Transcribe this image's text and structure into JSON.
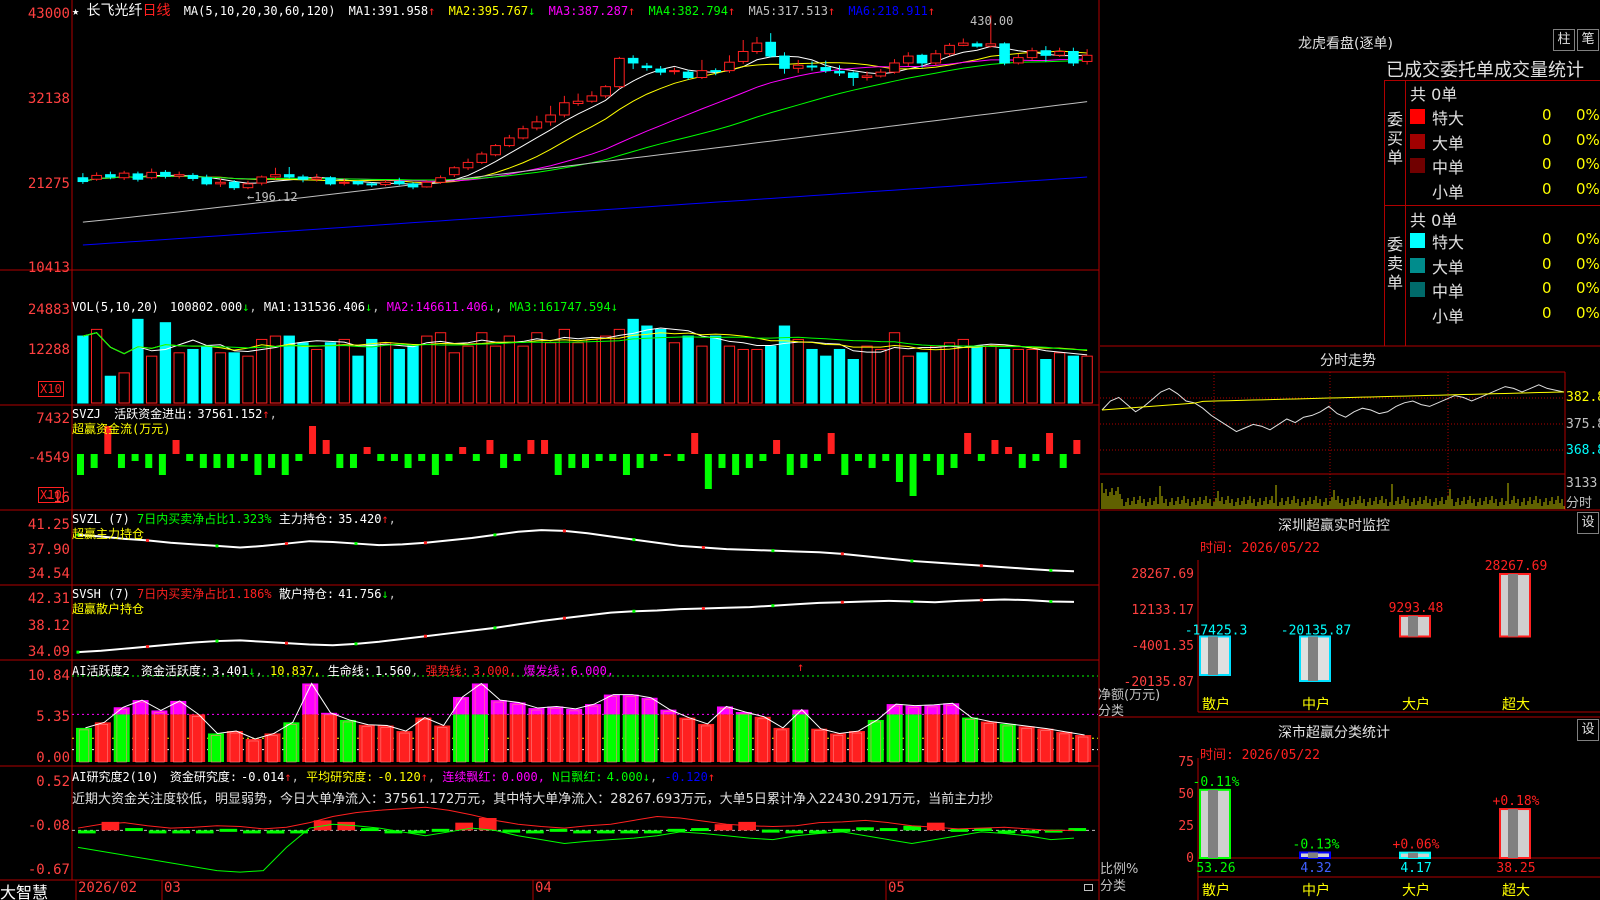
{
  "colors": {
    "up": "#ff2020",
    "down": "#00ffff",
    "grid": "#b00000",
    "ma1": "#ffffff",
    "ma2": "#ffff00",
    "ma3": "#ff00ff",
    "ma4": "#00ff00",
    "ma5": "#c0c0c0",
    "ma6": "#0000ff",
    "green": "#00ff00",
    "magenta": "#ff00ff"
  },
  "stock": {
    "name": "长飞光纤",
    "period": "日线"
  },
  "main": {
    "ma_label": "MA(5,10,20,30,60,120)",
    "ma": [
      {
        "k": "MA1:",
        "v": "391.958"
      },
      {
        "k": "MA2:",
        "v": "395.767"
      },
      {
        "k": "MA3:",
        "v": "387.287"
      },
      {
        "k": "MA4:",
        "v": "382.794"
      },
      {
        "k": "MA5:",
        "v": "317.513"
      },
      {
        "k": "MA6:",
        "v": "218.911"
      }
    ],
    "y_ticks": [
      "43000",
      "32138",
      "21275",
      "10413"
    ],
    "high_label": "430.00",
    "low_label": "196.12",
    "star": "★"
  },
  "vol": {
    "label": "VOL(5,10,20)",
    "value": "100802.000",
    "ma": [
      {
        "k": "MA1:",
        "v": "131536.406"
      },
      {
        "k": "MA2:",
        "v": "146611.406"
      },
      {
        "k": "MA3:",
        "v": "161747.594"
      }
    ],
    "y_ticks": [
      "24883",
      "12288"
    ],
    "unit": "X10"
  },
  "svzj": {
    "label": "SVZJ",
    "title": "活跃资金进出:",
    "value": "37561.152",
    "sub": "超赢资金流(万元)",
    "y_ticks": [
      "7432",
      "-4549",
      "-16"
    ],
    "unit": "X10"
  },
  "svzl": {
    "label": "SVZL (7)",
    "pct": "7日内买卖净占比1.323%",
    "k": "主力持仓:",
    "v": "35.420",
    "sub": "超赢主力持仓",
    "y_ticks": [
      "41.25",
      "37.90",
      "34.54"
    ]
  },
  "svsh": {
    "label": "SVSH (7)",
    "pct": "7日内买卖净占比1.186%",
    "k": "散户持仓:",
    "v": "41.756",
    "sub": "超赢散户持仓",
    "y_ticks": [
      "42.31",
      "38.12",
      "34.09"
    ]
  },
  "ai1": {
    "label": "AI活跃度2",
    "k1": "资金活跃度:",
    "v1": "3.401",
    "v2": "10.837",
    "k3": "生命线:",
    "v3": "1.560",
    "k4": "强势线:",
    "v4": "3.000",
    "k5": "爆发线:",
    "v5": "6.000",
    "y_ticks": [
      "10.84",
      "5.35",
      "0.00"
    ]
  },
  "ai2": {
    "label": "AI研究度2(10)",
    "k1": "资金研究度:",
    "v1": "-0.014",
    "k2": "平均研究度:",
    "v2": "-0.120",
    "k3": "连续飘红:",
    "v3": "0.000",
    "k4": "N日飘红:",
    "v4": "4.000",
    "v5": "-0.120",
    "note": "近期大资金关注度较低，明显弱势，今日大单净流入：37561.172万元，其中特大单净流入：28267.693万元，大单5日累计净入22430.291万元，当前主力抄",
    "y_ticks": [
      "0.52",
      "-0.08",
      "-0.67"
    ]
  },
  "xaxis": {
    "brand": "大智慧",
    "labels": [
      "2026/02",
      "03",
      "04",
      "05"
    ]
  },
  "right": {
    "lhb_title": "龙虎看盘(逐单)",
    "btn1": "柱",
    "btn2": "笔",
    "tabs": "已成交委托单成交量统计",
    "buy": {
      "side": "委买单",
      "total": "共 0单",
      "rows": [
        {
          "n": "特大",
          "v": "0",
          "p": "0%",
          "c": "#ff0000"
        },
        {
          "n": "大单",
          "v": "0",
          "p": "0%",
          "c": "#a00000"
        },
        {
          "n": "中单",
          "v": "0",
          "p": "0%",
          "c": "#700000"
        },
        {
          "n": "小单",
          "v": "0",
          "p": "0%",
          "c": "#000000"
        }
      ]
    },
    "sell": {
      "side": "委卖单",
      "total": "共 0单",
      "rows": [
        {
          "n": "特大",
          "v": "0",
          "p": "0%",
          "c": "#00ffff"
        },
        {
          "n": "大单",
          "v": "0",
          "p": "0%",
          "c": "#008c8c"
        },
        {
          "n": "中单",
          "v": "0",
          "p": "0%",
          "c": "#006a6a"
        },
        {
          "n": "小单",
          "v": "0",
          "p": "0%",
          "c": "#000000"
        }
      ]
    },
    "fs": {
      "title": "分时走势",
      "y": [
        "382.8",
        "375.8",
        "368.8",
        "3133"
      ],
      "unit": "分时"
    },
    "sz": {
      "title": "深圳超赢实时监控",
      "set": "设",
      "time": "时间: 2026/05/22",
      "y": [
        "28267.69",
        "12133.17",
        "-4001.35",
        "-20135.87"
      ],
      "ylab1": "净额(万元)",
      "ylab2": "分类",
      "cats": [
        "散户",
        "中户",
        "大户",
        "超大"
      ],
      "values": [
        -17425.3,
        -20135.87,
        9293.48,
        28267.69
      ],
      "labels": [
        "-17425.3",
        "-20135.87",
        "9293.48",
        "28267.69"
      ]
    },
    "sh": {
      "title": "深市超赢分类统计",
      "set": "设",
      "time": "时间: 2026/05/22",
      "y": [
        "75",
        "50",
        "25",
        "0"
      ],
      "ylab1": "比例%",
      "ylab2": "分类",
      "cats": [
        "散户",
        "中户",
        "大户",
        "超大"
      ],
      "pct": [
        53.26,
        4.32,
        4.17,
        38.25
      ],
      "pct_labels": [
        "53.26",
        "4.32",
        "4.17",
        "38.25"
      ],
      "chg": [
        "-0.11%",
        "-0.13%",
        "+0.06%",
        "+0.18%"
      ]
    }
  },
  "chart_data": [
    {
      "type": "candlestick",
      "title": "长飞光纤 日线",
      "ylim": [
        104.13,
        430.0
      ],
      "y_ticks": [
        "43000",
        "32138",
        "21275",
        "10413"
      ],
      "x": [
        "2026/02",
        "03",
        "04",
        "05"
      ],
      "ohlc": [
        [
          218,
          213,
          224,
          210
        ],
        [
          216,
          221,
          225,
          214
        ],
        [
          222,
          219,
          226,
          216
        ],
        [
          218,
          224,
          227,
          215
        ],
        [
          223,
          216,
          226,
          213
        ],
        [
          218,
          225,
          230,
          216
        ],
        [
          225,
          220,
          228,
          217
        ],
        [
          220,
          222,
          226,
          217
        ],
        [
          221,
          217,
          224,
          214
        ],
        [
          218,
          210,
          222,
          208
        ],
        [
          210,
          212,
          217,
          206
        ],
        [
          212,
          205,
          215,
          202
        ],
        [
          205,
          210,
          214,
          203
        ],
        [
          211,
          219,
          221,
          208
        ],
        [
          219,
          222,
          231,
          216
        ],
        [
          222,
          219,
          232,
          217
        ],
        [
          219,
          216,
          222,
          212
        ],
        [
          216,
          218,
          223,
          213
        ],
        [
          218,
          210,
          220,
          208
        ],
        [
          212,
          212,
          217,
          208
        ],
        [
          213,
          210,
          214,
          208
        ],
        [
          210,
          209,
          212,
          206
        ],
        [
          209,
          212,
          215,
          207
        ],
        [
          213,
          210,
          218,
          208
        ],
        [
          210,
          206,
          212,
          203
        ],
        [
          206,
          212,
          215,
          205
        ],
        [
          212,
          218,
          221,
          210
        ],
        [
          222,
          231,
          233,
          219
        ],
        [
          231,
          238,
          243,
          228
        ],
        [
          238,
          249,
          252,
          236
        ],
        [
          248,
          260,
          262,
          246
        ],
        [
          260,
          270,
          274,
          258
        ],
        [
          270,
          282,
          286,
          268
        ],
        [
          283,
          291,
          299,
          280
        ],
        [
          291,
          300,
          312,
          286
        ],
        [
          300,
          316,
          325,
          297
        ],
        [
          315,
          318,
          328,
          312
        ],
        [
          318,
          325,
          331,
          316
        ],
        [
          325,
          337,
          339,
          322
        ],
        [
          337,
          374,
          376,
          334
        ],
        [
          374,
          368,
          378,
          360
        ],
        [
          364,
          362,
          368,
          358
        ],
        [
          360,
          356,
          364,
          352
        ],
        [
          358,
          358,
          362,
          353
        ],
        [
          356,
          349,
          359,
          346
        ],
        [
          349,
          358,
          372,
          347
        ],
        [
          358,
          357,
          361,
          352
        ],
        [
          358,
          369,
          378,
          355
        ],
        [
          370,
          383,
          398,
          367
        ],
        [
          383,
          394,
          402,
          380
        ],
        [
          395,
          377,
          407,
          375
        ],
        [
          377,
          361,
          382,
          354
        ],
        [
          361,
          365,
          372,
          355
        ],
        [
          364,
          363,
          370,
          358
        ],
        [
          362,
          358,
          371,
          355
        ],
        [
          357,
          355,
          365,
          351
        ],
        [
          355,
          349,
          357,
          338
        ],
        [
          349,
          351,
          357,
          345
        ],
        [
          351,
          356,
          360,
          349
        ],
        [
          356,
          368,
          373,
          354
        ],
        [
          368,
          377,
          382,
          364
        ],
        [
          378,
          368,
          380,
          362
        ],
        [
          368,
          380,
          385,
          365
        ],
        [
          380,
          391,
          394,
          377
        ],
        [
          391,
          394,
          400,
          390
        ],
        [
          393,
          390,
          396,
          388
        ],
        [
          390,
          393,
          430,
          388
        ],
        [
          393,
          368,
          395,
          365
        ],
        [
          368,
          375,
          380,
          366
        ],
        [
          375,
          384,
          388,
          372
        ],
        [
          384,
          378,
          390,
          370
        ],
        [
          378,
          383,
          388,
          376
        ],
        [
          383,
          368,
          388,
          364
        ],
        [
          370,
          378,
          386,
          366
        ]
      ],
      "series": [
        {
          "name": "MA1",
          "last": 391.958
        },
        {
          "name": "MA2",
          "last": 395.767
        },
        {
          "name": "MA3",
          "last": 387.287
        },
        {
          "name": "MA4",
          "last": 382.794
        },
        {
          "name": "MA5",
          "last": 317.513
        },
        {
          "name": "MA6",
          "last": 218.911
        }
      ]
    },
    {
      "type": "bar",
      "title": "VOL(5,10,20)",
      "values": [
        20,
        22,
        8,
        9,
        25,
        14,
        24,
        15,
        16,
        17,
        15,
        15,
        14,
        19,
        20,
        20,
        18,
        16,
        18,
        19,
        14,
        19,
        18,
        16,
        17,
        20,
        21,
        15,
        17,
        21,
        17,
        20,
        17,
        21,
        18,
        22,
        18,
        19,
        20,
        22,
        25,
        23,
        22,
        18,
        20,
        17,
        20,
        17,
        16,
        16,
        17,
        23,
        19,
        16,
        14,
        16,
        13,
        17,
        16,
        21,
        14,
        15,
        17,
        18,
        19,
        17,
        17,
        16,
        16,
        16,
        13,
        15,
        14,
        14,
        12,
        11,
        14,
        10
      ],
      "ylim": [
        0,
        24883
      ]
    },
    {
      "type": "bar",
      "title": "超赢资金流(万元)",
      "values": [
        -3,
        -2,
        4,
        -2,
        -1,
        -2,
        -3,
        2,
        -1,
        -2,
        -2,
        -2,
        -1,
        -3,
        -2,
        -3,
        -1,
        4,
        2,
        -2,
        -2,
        1,
        -1,
        -1,
        -2,
        -1,
        -3,
        -1,
        1,
        -1,
        2,
        -2,
        -1,
        2,
        2,
        -3,
        -2,
        -2,
        -1,
        -1,
        -3,
        -2,
        -1,
        0,
        -1,
        3,
        -5,
        -2,
        -3,
        -2,
        -1,
        2,
        -3,
        -2,
        -1,
        3,
        -3,
        -1,
        -2,
        -1,
        -4,
        -6,
        -1,
        -3,
        -2,
        3,
        -1,
        2,
        1,
        -2,
        -1,
        3,
        -2,
        2
      ],
      "ylim": [
        -16,
        7432
      ]
    },
    {
      "type": "line",
      "title": "超赢主力持仓",
      "ylim": [
        34.54,
        41.25
      ],
      "values": [
        40.0,
        39.8,
        39.5,
        39.3,
        39.0,
        38.8,
        38.6,
        38.4,
        38.6,
        38.9,
        39.2,
        39.1,
        38.9,
        38.7,
        38.8,
        39.0,
        39.3,
        39.6,
        40.0,
        40.4,
        40.6,
        40.5,
        40.2,
        39.8,
        39.4,
        39.0,
        38.6,
        38.4,
        38.2,
        38.1,
        38.0,
        37.9,
        37.8,
        37.6,
        37.3,
        37.0,
        36.7,
        36.5,
        36.3,
        36.1,
        35.9,
        35.7,
        35.5,
        35.4
      ]
    },
    {
      "type": "line",
      "title": "超赢散户持仓",
      "ylim": [
        34.09,
        42.31
      ],
      "values": [
        34.5,
        34.7,
        35.0,
        35.3,
        35.6,
        35.9,
        36.1,
        36.2,
        36.0,
        35.8,
        35.6,
        35.5,
        35.7,
        36.0,
        36.4,
        36.8,
        37.2,
        37.6,
        38.0,
        38.5,
        39.0,
        39.4,
        39.8,
        40.2,
        40.4,
        40.5,
        40.7,
        40.8,
        40.9,
        41.0,
        41.2,
        41.4,
        41.6,
        41.7,
        41.8,
        41.9,
        41.8,
        41.7,
        41.9,
        42.0,
        42.1,
        42.0,
        41.8,
        41.756
      ]
    },
    {
      "type": "bar",
      "title": "AI活跃度2",
      "ylim": [
        0,
        10.84
      ],
      "values": [
        4.3,
        5.0,
        6.9,
        7.8,
        6.5,
        7.7,
        6.0,
        3.6,
        3.9,
        2.9,
        3.6,
        5.0,
        9.9,
        6.2,
        5.3,
        4.7,
        4.6,
        3.9,
        5.6,
        4.6,
        8.2,
        9.9,
        7.8,
        7.5,
        6.8,
        7.0,
        6.7,
        7.3,
        8.5,
        8.5,
        8.1,
        6.6,
        5.6,
        4.8,
        7.0,
        6.3,
        5.7,
        4.3,
        6.6,
        4.2,
        3.6,
        3.9,
        5.3,
        7.3,
        7.1,
        7.2,
        7.4,
        5.6,
        5.1,
        4.8,
        4.5,
        4.2,
        3.8,
        3.4
      ],
      "lines": [
        {
          "name": "强势线",
          "value": 3.0
        },
        {
          "name": "爆发线",
          "value": 6.0
        },
        {
          "name": "生命线",
          "value": 1.56
        }
      ]
    },
    {
      "type": "bar",
      "title": "AI研究度2(10)",
      "ylim": [
        -0.67,
        0.52
      ],
      "values": [
        -0.1,
        0.05,
        -0.05,
        -0.08,
        -0.1,
        -0.08,
        -0.06,
        -0.1,
        -0.12,
        -0.08,
        0.07,
        0.05,
        -0.05,
        -0.08,
        -0.1,
        -0.06,
        0.04,
        0.1,
        -0.07,
        -0.1,
        -0.06,
        -0.1,
        -0.08,
        -0.09,
        -0.08,
        -0.06,
        -0.05,
        0.02,
        0.05,
        -0.07,
        -0.1,
        -0.08,
        -0.06,
        -0.04,
        -0.05,
        -0.02,
        0.04,
        -0.06,
        -0.05,
        -0.08,
        -0.1,
        -0.07,
        -0.05
      ]
    },
    {
      "type": "bar",
      "title": "深圳超赢实时监控",
      "categories": [
        "散户",
        "中户",
        "大户",
        "超大"
      ],
      "values": [
        -17425.3,
        -20135.87,
        9293.48,
        28267.69
      ],
      "ylim": [
        -20135.87,
        28267.69
      ]
    },
    {
      "type": "bar",
      "title": "深市超赢分类统计",
      "categories": [
        "散户",
        "中户",
        "大户",
        "超大"
      ],
      "values": [
        53.26,
        4.32,
        4.17,
        38.25
      ],
      "ylim": [
        0,
        75
      ]
    }
  ]
}
